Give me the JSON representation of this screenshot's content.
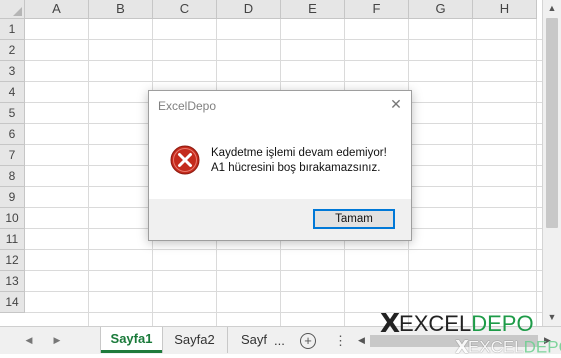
{
  "sheet": {
    "columns": [
      "A",
      "B",
      "C",
      "D",
      "E",
      "F",
      "G",
      "H"
    ],
    "rows": [
      "1",
      "2",
      "3",
      "4",
      "5",
      "6",
      "7",
      "8",
      "9",
      "10",
      "11",
      "12",
      "13",
      "14"
    ]
  },
  "tabs": {
    "active": "Sayfa1",
    "second": "Sayfa2",
    "third": "Sayf",
    "ellipsis": "...",
    "add_icon": "plus-circle-icon"
  },
  "dialog": {
    "title": "ExcelDepo",
    "line1": "Kaydetme işlemi devam edemiyor!",
    "line2": "A1 hücresini boş bırakamazsınız.",
    "ok_label": "Tamam",
    "icon": "error-icon"
  },
  "watermark": {
    "x": "X",
    "excel": "EXCEL",
    "depo": "DEPO"
  },
  "colors": {
    "accent": "#1e7b3c",
    "error": "#c42b1c",
    "depo_green": "#1e9b48"
  }
}
